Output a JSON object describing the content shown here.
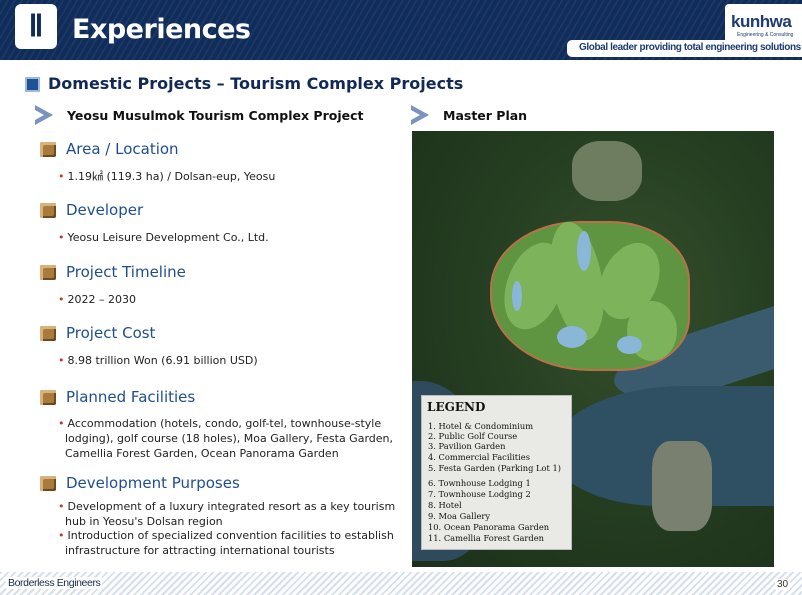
{
  "header": {
    "section_numeral": "Ⅱ",
    "title": "Experiences",
    "logo_name": "kunhwa",
    "logo_sub": "Engineering & Consulting",
    "tagline": "Global leader providing total engineering solutions",
    "bg_color": "#0f2c5a"
  },
  "section": {
    "title": "Domestic Projects – Tourism Complex Projects"
  },
  "left": {
    "project_title": "Yeosu Musulmok Tourism Complex Project",
    "items": [
      {
        "heading": "Area / Location",
        "bullets": [
          "1.19㎢ (119.3 ha) / Dolsan-eup, Yeosu"
        ]
      },
      {
        "heading": "Developer",
        "bullets": [
          "Yeosu Leisure Development Co., Ltd."
        ]
      },
      {
        "heading": "Project Timeline",
        "bullets": [
          "2022 – 2030"
        ]
      },
      {
        "heading": "Project Cost",
        "bullets": [
          "8.98 trillion Won (6.91 billion USD)"
        ]
      },
      {
        "heading": "Planned Facilities",
        "bullets": [
          "Accommodation (hotels, condo, golf-tel, townhouse-style lodging), golf course (18 holes), Moa Gallery, Festa Garden, Camellia Forest Garden, Ocean Panorama Garden"
        ]
      },
      {
        "heading": "Development Purposes",
        "bullets": [
          "Development of a luxury integrated resort as a key tourism hub in Yeosu's Dolsan region",
          "Introduction of specialized convention facilities to establish infrastructure for attracting international tourists"
        ]
      }
    ]
  },
  "right": {
    "title": "Master Plan",
    "legend": {
      "title": "LEGEND",
      "items": [
        "1.   Hotel & Condominium",
        "2.   Public Golf Course",
        "3.   Pavilion Garden",
        "4.   Commercial Facilities",
        "5.   Festa Garden (Parking Lot 1)",
        "6. Townhouse Lodging 1",
        "7. Townhouse Lodging 2",
        "8. Hotel",
        "9. Moa Gallery",
        "10. Ocean Panorama Garden",
        "11. Camellia Forest Garden"
      ]
    }
  },
  "footer": {
    "left_text": "Borderless Engineers",
    "page_number": "30"
  }
}
